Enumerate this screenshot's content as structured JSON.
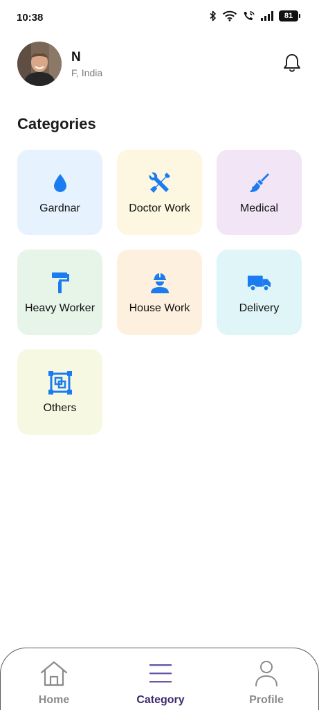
{
  "status_bar": {
    "time": "10:38",
    "battery": "81",
    "icons": [
      "bluetooth-icon",
      "wifi-icon",
      "wifi-call-icon",
      "signal-icon",
      "battery-icon"
    ]
  },
  "header": {
    "user_name": "N",
    "location": "F, India",
    "avatar": "user-avatar",
    "notification_icon": "bell-icon"
  },
  "categories": {
    "title": "Categories",
    "items": [
      {
        "label": "Gardnar",
        "icon": "water-drop-icon",
        "bg": "#e6f2fd"
      },
      {
        "label": "Doctor Work",
        "icon": "tools-icon",
        "bg": "#fdf6e1"
      },
      {
        "label": "Medical",
        "icon": "broom-icon",
        "bg": "#f1e5f6"
      },
      {
        "label": "Heavy Worker",
        "icon": "paint-roller-icon",
        "bg": "#e7f4e8"
      },
      {
        "label": "House Work",
        "icon": "construction-worker-icon",
        "bg": "#fef0df"
      },
      {
        "label": "Delivery",
        "icon": "truck-icon",
        "bg": "#dff5f8"
      },
      {
        "label": "Others",
        "icon": "select-frame-icon",
        "bg": "#f6f8e2"
      }
    ]
  },
  "bottom_nav": {
    "items": [
      {
        "label": "Home",
        "icon": "home-icon",
        "active": false
      },
      {
        "label": "Category",
        "icon": "menu-icon",
        "active": true
      },
      {
        "label": "Profile",
        "icon": "profile-icon",
        "active": false
      }
    ]
  },
  "colors": {
    "accent_icon": "#1a7cf0",
    "nav_active": "#3b2a6e",
    "nav_active_icon": "#6b55a8",
    "nav_inactive": "#8a8a8a"
  }
}
